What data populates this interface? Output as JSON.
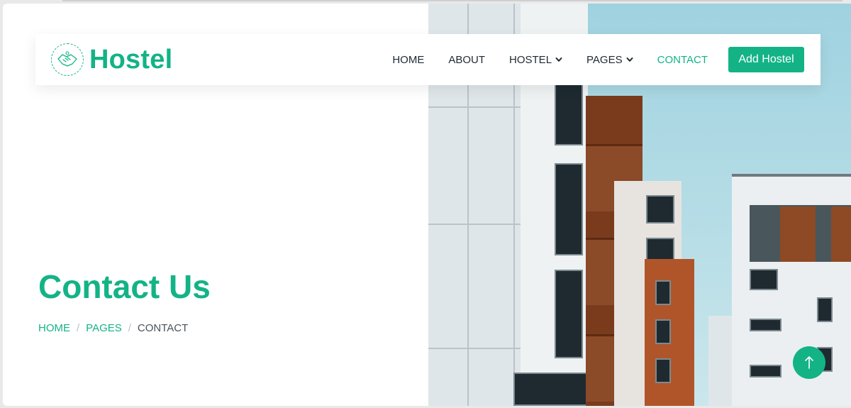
{
  "brand": {
    "name": "Hostel"
  },
  "nav": {
    "items": [
      {
        "label": "HOME",
        "dropdown": false,
        "active": false
      },
      {
        "label": "ABOUT",
        "dropdown": false,
        "active": false
      },
      {
        "label": "HOSTEL",
        "dropdown": true,
        "active": false
      },
      {
        "label": "PAGES",
        "dropdown": true,
        "active": false
      },
      {
        "label": "CONTACT",
        "dropdown": false,
        "active": true
      }
    ],
    "cta_label": "Add Hostel"
  },
  "page": {
    "title": "Contact Us"
  },
  "breadcrumb": {
    "items": [
      "HOME",
      "PAGES"
    ],
    "separator": "/",
    "current": "CONTACT"
  },
  "icons": {
    "logo": "handshake-icon",
    "dropdown": "chevron-down-icon",
    "back_to_top": "arrow-up-icon"
  },
  "colors": {
    "accent": "#13b386",
    "text": "#1e2a33"
  }
}
